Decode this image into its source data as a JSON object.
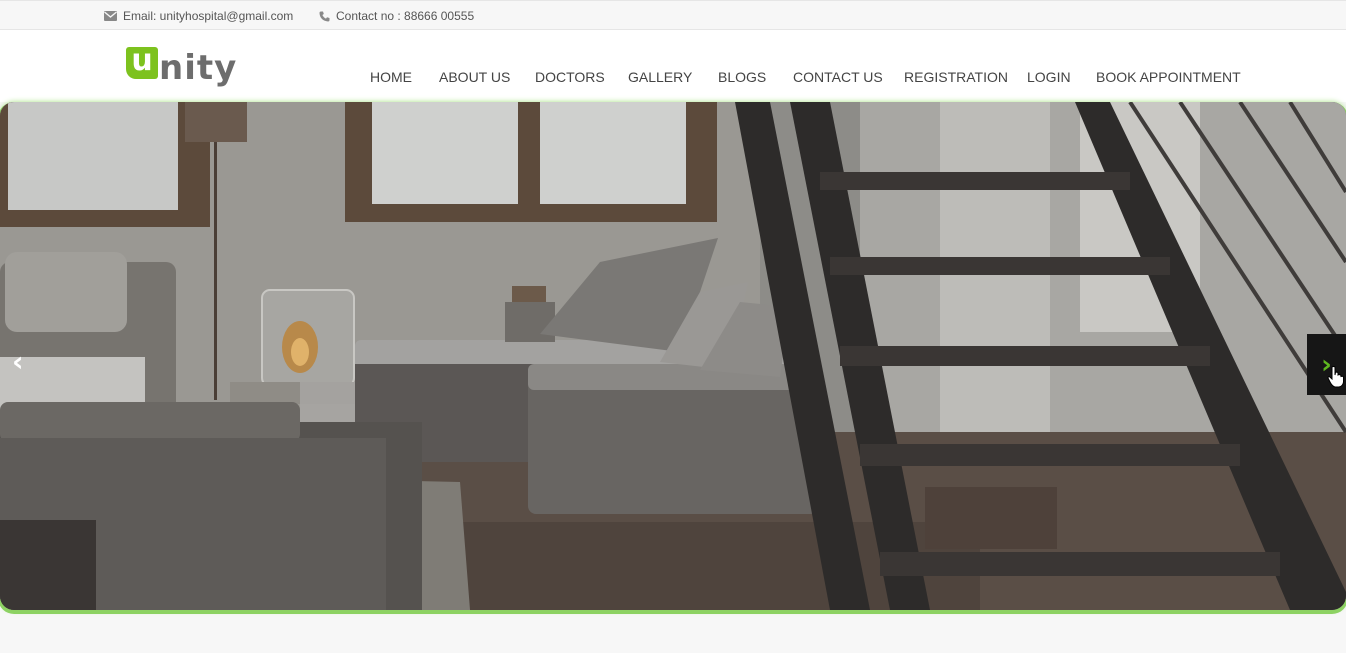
{
  "topbar": {
    "email": "Email: unityhospital@gmail.com",
    "contact": "Contact no : 88666 00555",
    "email_icon": "envelope-icon",
    "phone_icon": "phone-icon"
  },
  "logo": {
    "mark": "u",
    "rest": "nity"
  },
  "nav": {
    "items": [
      {
        "label": "HOME"
      },
      {
        "label": "ABOUT US"
      },
      {
        "label": "DOCTORS"
      },
      {
        "label": "GALLERY"
      },
      {
        "label": "BLOGS"
      },
      {
        "label": "CONTACT US"
      },
      {
        "label": "REGISTRATION"
      },
      {
        "label": "LOGIN"
      },
      {
        "label": "BOOK APPOINTMENT"
      }
    ]
  },
  "slider": {
    "prev_label": "‹",
    "next_label": "›",
    "prev_icon": "chevron-left-icon",
    "next_icon": "chevron-right-icon"
  },
  "colors": {
    "brand_green": "#7dc21e",
    "nav_text": "#444444",
    "topbar_bg": "#f7f7f7"
  }
}
